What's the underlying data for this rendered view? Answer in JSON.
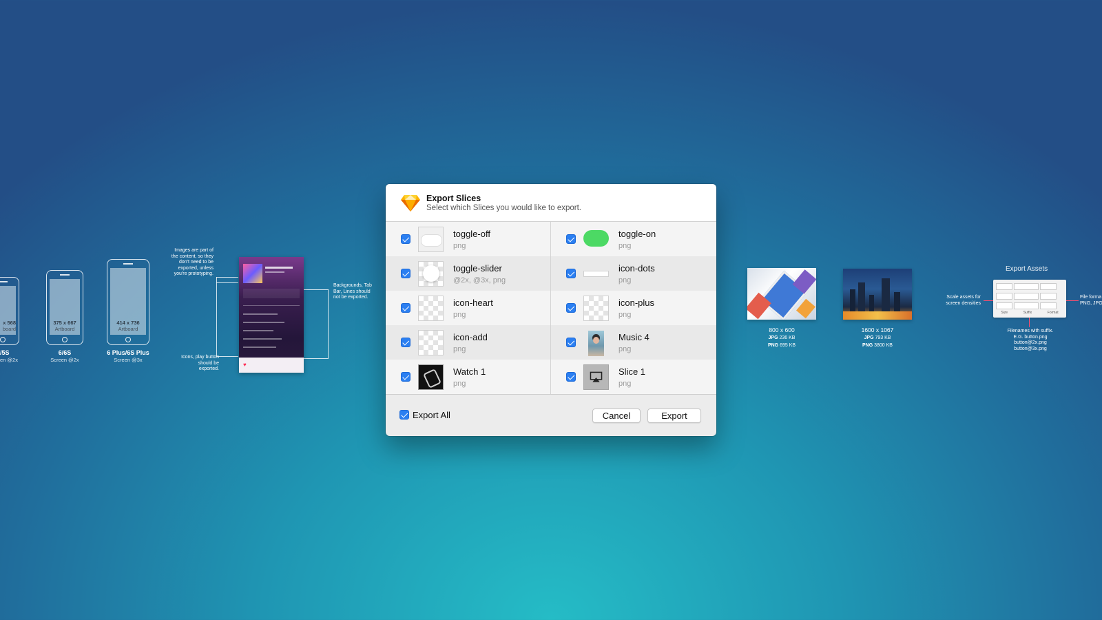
{
  "dialog": {
    "title": "Export Slices",
    "subtitle": "Select which Slices you would like to export.",
    "left_items": [
      {
        "name": "toggle-off",
        "format": "png"
      },
      {
        "name": "toggle-slider",
        "format": "@2x, @3x, png"
      },
      {
        "name": "icon-heart",
        "format": "png"
      },
      {
        "name": "icon-add",
        "format": "png"
      },
      {
        "name": "Watch 1",
        "format": "png"
      }
    ],
    "right_items": [
      {
        "name": "toggle-on",
        "format": "png"
      },
      {
        "name": "icon-dots",
        "format": "png"
      },
      {
        "name": "icon-plus",
        "format": "png"
      },
      {
        "name": "Music 4",
        "format": "png"
      },
      {
        "name": "Slice 1",
        "format": "png"
      }
    ],
    "export_all_label": "Export All",
    "cancel_label": "Cancel",
    "export_label": "Export",
    "accent_color": "#2b7ff1",
    "toggle_on_color": "#4cd964"
  },
  "background": {
    "phones": [
      {
        "dims": "x 568",
        "art": "board",
        "label": "/5S",
        "sub": "en @2x"
      },
      {
        "dims": "375 x 667",
        "art": "Artboard",
        "label": "6/6S",
        "sub": "Screen @2x"
      },
      {
        "dims": "414 x 736",
        "art": "Artboard",
        "label": "6 Plus/6S Plus",
        "sub": "Screen @3x"
      }
    ],
    "notes": {
      "images": "Images are part of the content, so they don't need to be exported, unless you're prototyping.",
      "icons": "Icons, play button should be exported.",
      "backgrounds": "Backgrounds, Tab Bar, Lines should not be exported.",
      "scale": "Scale assets for screen densities",
      "file_format": "File forma PNG, JPG",
      "filenames": "Filenames with suffix. E.G. button.png button@2x.png button@3x.png"
    },
    "thumbs": [
      {
        "dims": "800 x 600",
        "jpg_label": "JPG",
        "jpg": "236 KB",
        "png_label": "PNG",
        "png": "695 KB"
      },
      {
        "dims": "1600 x 1067",
        "jpg_label": "JPG",
        "jpg": "793 KB",
        "png_label": "PNG",
        "png": "3800 KB"
      }
    ],
    "export_assets_title": "Export Assets",
    "export_assets_cols": [
      "Size",
      "Suffix",
      "Format"
    ]
  }
}
